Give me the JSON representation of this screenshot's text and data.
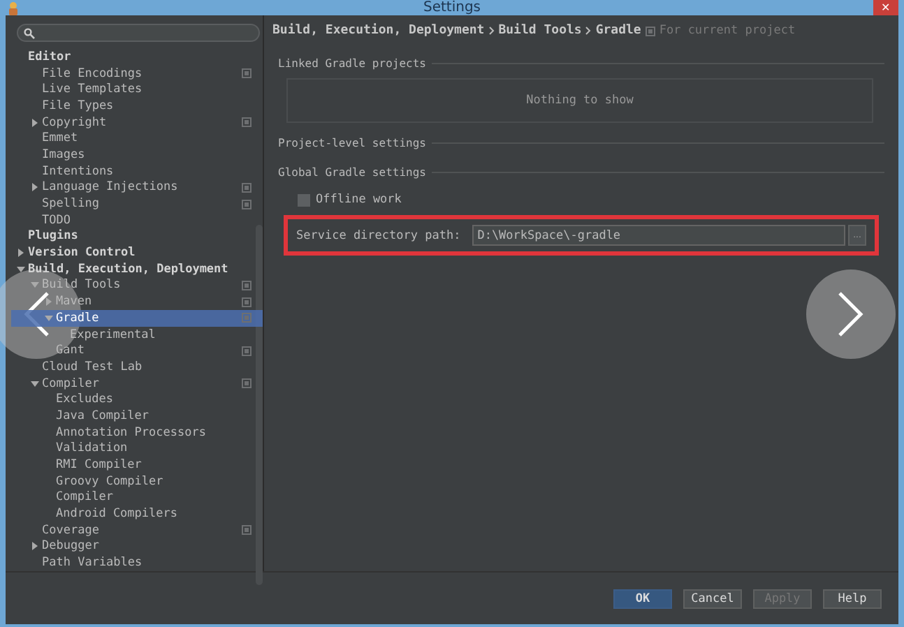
{
  "window": {
    "title": "Settings",
    "close": "✕"
  },
  "tree": [
    {
      "label": "Editor",
      "children": [
        {
          "label": "File Encodings",
          "project": true
        },
        {
          "label": "Live Templates"
        },
        {
          "label": "File Types"
        },
        {
          "label": "Copyright",
          "expanded": false,
          "project": true
        },
        {
          "label": "Emmet"
        },
        {
          "label": "Images"
        },
        {
          "label": "Intentions"
        },
        {
          "label": "Language Injections",
          "expanded": false,
          "project": true
        },
        {
          "label": "Spelling",
          "project": true
        },
        {
          "label": "TODO"
        }
      ]
    },
    {
      "label": "Plugins"
    },
    {
      "label": "Version Control",
      "expanded": false
    },
    {
      "label": "Build, Execution, Deployment",
      "expanded": true,
      "children": [
        {
          "label": "Build Tools",
          "expanded": true,
          "project": true,
          "children": [
            {
              "label": "Maven",
              "expanded": false,
              "project": true
            },
            {
              "label": "Gradle",
              "expanded": true,
              "selected": true,
              "project": true,
              "children": [
                {
                  "label": "Experimental"
                }
              ]
            },
            {
              "label": "Gant",
              "project": true
            }
          ]
        },
        {
          "label": "Cloud Test Lab"
        },
        {
          "label": "Compiler",
          "expanded": true,
          "project": true,
          "children": [
            {
              "label": "Excludes"
            },
            {
              "label": "Java Compiler"
            },
            {
              "label": "Annotation Processors"
            },
            {
              "label": "Validation"
            },
            {
              "label": "RMI Compiler"
            },
            {
              "label": "Groovy Compiler"
            },
            {
              "label": "Compiler"
            },
            {
              "label": "Android Compilers"
            }
          ]
        },
        {
          "label": "Coverage",
          "project": true
        },
        {
          "label": "Debugger",
          "expanded": false
        },
        {
          "label": "Path Variables"
        }
      ]
    }
  ],
  "breadcrumb": [
    "Build, Execution, Deployment",
    "Build Tools",
    "Gradle"
  ],
  "scope_note": "For current project",
  "sections": [
    {
      "title": "Linked Gradle projects",
      "empty_text": "Nothing to show"
    },
    {
      "title": "Project-level settings"
    },
    {
      "title": "Global Gradle settings"
    }
  ],
  "offline_work": {
    "label": "Offline work",
    "checked": false
  },
  "service_path": {
    "label": "Service directory path:",
    "value": "D:\\WorkSpace\\-gradle",
    "browse": "..."
  },
  "buttons": [
    {
      "label": "OK",
      "kind": "default",
      "disabled": false
    },
    {
      "label": "Cancel",
      "kind": "normal",
      "disabled": false
    },
    {
      "label": "Apply",
      "kind": "normal",
      "disabled": true
    },
    {
      "label": "Help",
      "kind": "normal",
      "disabled": false
    }
  ]
}
